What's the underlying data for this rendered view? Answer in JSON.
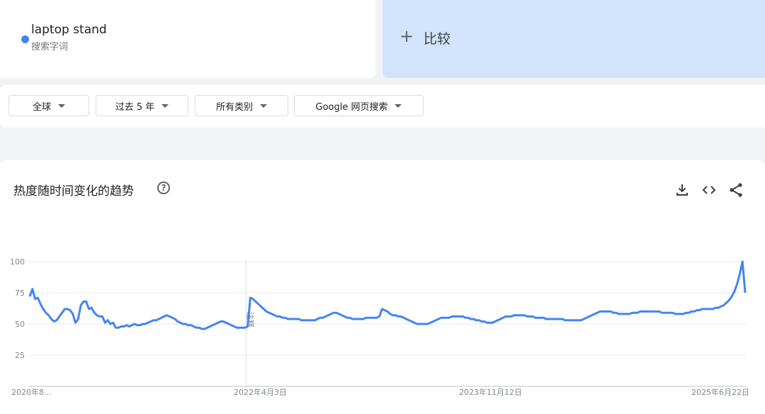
{
  "search_term": {
    "name": "laptop stand",
    "type": "搜索字词",
    "color": "#4285f4"
  },
  "compare": {
    "plus": "+",
    "label": "比较"
  },
  "filters": {
    "region": "全球",
    "time_range": "过去 5 年",
    "category": "所有类别",
    "search_type": "Google 网页搜索"
  },
  "chart_card": {
    "title": "热度随时间变化的趋势",
    "help_icon": "?",
    "icons": [
      "download-icon",
      "embed-icon",
      "share-icon"
    ]
  },
  "chart_data": {
    "type": "line",
    "title": "",
    "xlabel": "",
    "ylabel": "",
    "ylim": [
      0,
      100
    ],
    "yticks": [
      100,
      75,
      50,
      25
    ],
    "xticks": [
      "2020年8…",
      "2022年4月3日",
      "2023年11月12日",
      "2025年6月22日"
    ],
    "annotation": {
      "text": "注释",
      "week_index": 82
    },
    "series": [
      {
        "name": "laptop stand",
        "color": "#4285f4",
        "values": [
          72,
          78,
          70,
          71,
          66,
          62,
          59,
          57,
          54,
          52,
          53,
          56,
          59,
          62,
          62,
          61,
          58,
          51,
          54,
          65,
          68,
          68,
          62,
          63,
          59,
          57,
          56,
          56,
          51,
          53,
          50,
          51,
          47,
          47,
          48,
          48,
          49,
          48,
          49,
          50,
          49,
          49,
          50,
          50,
          51,
          52,
          53,
          53,
          54,
          55,
          56,
          57,
          56,
          55,
          54,
          52,
          51,
          50,
          50,
          49,
          49,
          48,
          47,
          47,
          46,
          46,
          47,
          48,
          49,
          50,
          51,
          52,
          52,
          51,
          50,
          49,
          48,
          47,
          47,
          47,
          47,
          48,
          71,
          70,
          68,
          66,
          64,
          62,
          60,
          59,
          58,
          57,
          56,
          56,
          55,
          55,
          54,
          54,
          54,
          54,
          54,
          53,
          53,
          53,
          53,
          53,
          53,
          54,
          55,
          55,
          56,
          57,
          58,
          59,
          59,
          58,
          57,
          56,
          55,
          55,
          54,
          54,
          54,
          54,
          54,
          55,
          55,
          55,
          55,
          55,
          56,
          62,
          61,
          60,
          58,
          57,
          57,
          56,
          56,
          55,
          54,
          53,
          52,
          51,
          50,
          50,
          50,
          50,
          50,
          51,
          52,
          53,
          54,
          55,
          55,
          55,
          55,
          56,
          56,
          56,
          56,
          56,
          55,
          55,
          54,
          54,
          53,
          53,
          52,
          52,
          51,
          51,
          51,
          52,
          53,
          54,
          55,
          56,
          56,
          56,
          57,
          57,
          57,
          57,
          57,
          56,
          56,
          56,
          55,
          55,
          55,
          55,
          54,
          54,
          54,
          54,
          54,
          54,
          54,
          53,
          53,
          53,
          53,
          53,
          53,
          53,
          54,
          55,
          56,
          57,
          58,
          59,
          60,
          60,
          60,
          60,
          60,
          59,
          59,
          58,
          58,
          58,
          58,
          58,
          59,
          59,
          59,
          60,
          60,
          60,
          60,
          60,
          60,
          60,
          60,
          59,
          59,
          59,
          59,
          59,
          58,
          58,
          58,
          58,
          59,
          59,
          60,
          60,
          61,
          61,
          62,
          62,
          62,
          62,
          62,
          63,
          63,
          64,
          65,
          67,
          69,
          72,
          76,
          82,
          90,
          100,
          75
        ]
      }
    ]
  }
}
